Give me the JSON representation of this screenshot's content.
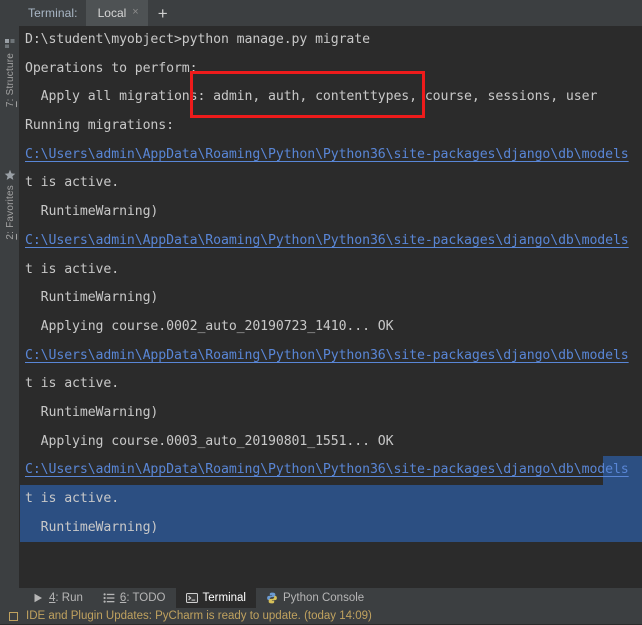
{
  "tabbar": {
    "title": "Terminal:",
    "active_tab": "Local",
    "close_glyph": "×",
    "add_glyph": "+"
  },
  "left_tools": [
    {
      "label_prefix": "7",
      "label_suffix": ": Structure",
      "icon": "structure-icon"
    },
    {
      "label_prefix": "2",
      "label_suffix": ": Favorites",
      "icon": "star-icon"
    }
  ],
  "terminal": {
    "lines": [
      {
        "text": "D:\\student\\myobject>python manage.py migrate",
        "style": "normal"
      },
      {
        "text": "Operations to perform:",
        "style": "normal"
      },
      {
        "text": "  Apply all migrations: admin, auth, contenttypes, course, sessions, user",
        "style": "normal"
      },
      {
        "text": "Running migrations:",
        "style": "normal"
      },
      {
        "text": "C:\\Users\\admin\\AppData\\Roaming\\Python\\Python36\\site-packages\\django\\db\\models",
        "style": "link"
      },
      {
        "text": "t is active.",
        "style": "normal"
      },
      {
        "text": "  RuntimeWarning)",
        "style": "normal"
      },
      {
        "text": "C:\\Users\\admin\\AppData\\Roaming\\Python\\Python36\\site-packages\\django\\db\\models",
        "style": "link"
      },
      {
        "text": "t is active.",
        "style": "normal"
      },
      {
        "text": "  RuntimeWarning)",
        "style": "normal"
      },
      {
        "text": "  Applying course.0002_auto_20190723_1410... OK",
        "style": "normal"
      },
      {
        "text": "C:\\Users\\admin\\AppData\\Roaming\\Python\\Python36\\site-packages\\django\\db\\models",
        "style": "link"
      },
      {
        "text": "t is active.",
        "style": "normal"
      },
      {
        "text": "  RuntimeWarning)",
        "style": "normal"
      },
      {
        "text": "  Applying course.0003_auto_20190801_1551... OK",
        "style": "normal"
      },
      {
        "text": "C:\\Users\\admin\\AppData\\Roaming\\Python\\Python36\\site-packages\\django\\db\\models",
        "style": "link-sel-partial"
      },
      {
        "text": "t is active.",
        "style": "selected"
      },
      {
        "text": "  RuntimeWarning)",
        "style": "selected"
      }
    ],
    "highlight_color": "#ee1b1b",
    "selection_color": "#2c4f82",
    "link_color": "#5986d6"
  },
  "bottom_bar": {
    "items": [
      {
        "num": "4",
        "label": ": Run",
        "icon": "play-icon",
        "active": false
      },
      {
        "num": "6",
        "label": ": TODO",
        "icon": "todo-icon",
        "active": false
      },
      {
        "num": "",
        "label": "Terminal",
        "icon": "terminal-icon",
        "active": true
      },
      {
        "num": "",
        "label": "Python Console",
        "icon": "python-icon",
        "active": false
      }
    ]
  },
  "status_bar": {
    "message": "IDE and Plugin Updates: PyCharm is ready to update. (today 14:09)",
    "icon": "update-icon",
    "color": "#c0a25f"
  }
}
